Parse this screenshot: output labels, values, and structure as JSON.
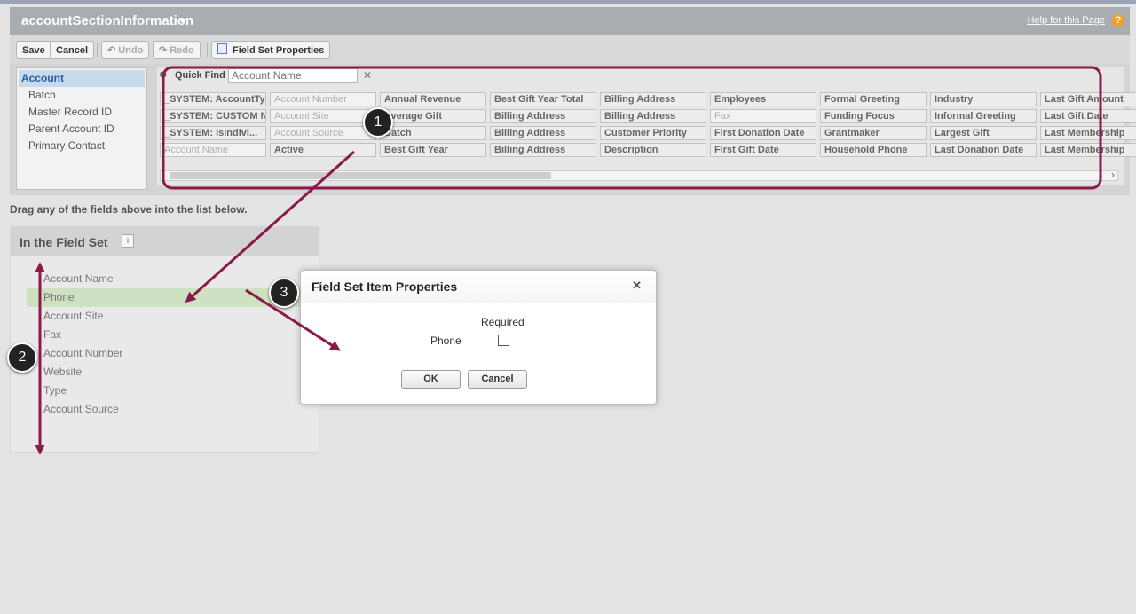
{
  "header": {
    "title": "accountSectionInformation",
    "help_link": "Help for this Page",
    "help_icon": "?"
  },
  "toolbar": {
    "save": "Save",
    "cancel": "Cancel",
    "undo": "Undo",
    "redo": "Redo",
    "field_set_properties": "Field Set Properties"
  },
  "objects": {
    "selected": "Account",
    "items": [
      "Batch",
      "Master Record ID",
      "Parent Account ID",
      "Primary Contact"
    ]
  },
  "quick_find": {
    "label": "Quick Find",
    "placeholder": "Account Name",
    "clear": "✕"
  },
  "field_rows": [
    [
      {
        "t": "_SYSTEM: AccountType",
        "u": false
      },
      {
        "t": "Account Number",
        "u": true
      },
      {
        "t": "Annual Revenue",
        "u": false
      },
      {
        "t": "Best Gift Year Total",
        "u": false
      },
      {
        "t": "Billing Address",
        "u": false
      },
      {
        "t": "Employees",
        "u": false
      },
      {
        "t": "Formal Greeting",
        "u": false
      },
      {
        "t": "Industry",
        "u": false
      },
      {
        "t": "Last Gift Amount",
        "u": false
      }
    ],
    [
      {
        "t": "_SYSTEM: CUSTOM N...",
        "u": false
      },
      {
        "t": "Account Site",
        "u": true
      },
      {
        "t": "Average Gift",
        "u": false
      },
      {
        "t": "Billing Address",
        "u": false
      },
      {
        "t": "Billing Address",
        "u": false
      },
      {
        "t": "Fax",
        "u": true
      },
      {
        "t": "Funding Focus",
        "u": false
      },
      {
        "t": "Informal Greeting",
        "u": false
      },
      {
        "t": "Last Gift Date",
        "u": false
      }
    ],
    [
      {
        "t": "_SYSTEM: IsIndivi...",
        "u": false
      },
      {
        "t": "Account Source",
        "u": true
      },
      {
        "t": "Batch",
        "u": false
      },
      {
        "t": "Billing Address",
        "u": false
      },
      {
        "t": "Customer Priority",
        "u": false
      },
      {
        "t": "First Donation Date",
        "u": false
      },
      {
        "t": "Grantmaker",
        "u": false
      },
      {
        "t": "Largest Gift",
        "u": false
      },
      {
        "t": "Last Membership",
        "u": false
      }
    ],
    [
      {
        "t": "Account Name",
        "u": true
      },
      {
        "t": "Active",
        "u": false
      },
      {
        "t": "Best Gift Year",
        "u": false
      },
      {
        "t": "Billing Address",
        "u": false
      },
      {
        "t": "Description",
        "u": false
      },
      {
        "t": "First Gift Date",
        "u": false
      },
      {
        "t": "Household Phone",
        "u": false
      },
      {
        "t": "Last Donation Date",
        "u": false
      },
      {
        "t": "Last Membership",
        "u": false
      }
    ]
  ],
  "scroll_right": "›",
  "instructions": "Drag any of the fields above into the list below.",
  "field_set": {
    "title": "In the Field Set",
    "info_icon": "i",
    "items": [
      "Account Name",
      "Phone",
      "Account Site",
      "Fax",
      "Account Number",
      "Website",
      "Type",
      "Account Source"
    ],
    "selected_index": 1
  },
  "modal": {
    "title": "Field Set Item Properties",
    "close": "✕",
    "required_header": "Required",
    "field_label": "Phone",
    "required_checked": false,
    "ok": "OK",
    "cancel": "Cancel"
  },
  "annotations": {
    "color": "#8b1a4a",
    "steps": [
      "1",
      "2",
      "3"
    ]
  }
}
